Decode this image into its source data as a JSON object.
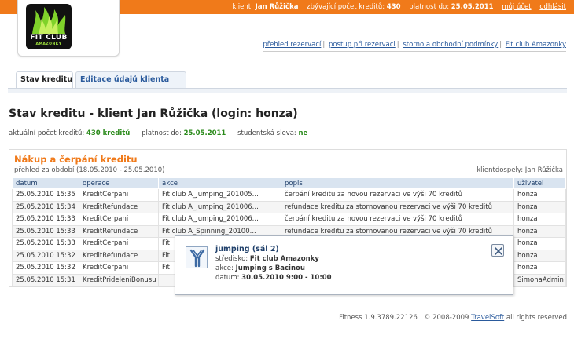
{
  "topbar": {
    "client_label": "klient:",
    "client_name": "Jan Růžička",
    "credits_label": "zbývající počet kreditů:",
    "credits_value": "430",
    "valid_label": "platnost do:",
    "valid_value": "25.05.2011",
    "account_link": "můj účet",
    "logout_link": "odhlásit",
    "accent_color": "#f07a1a"
  },
  "logo": {
    "line1": "FIT CLUB",
    "line2": "AMAZONKY"
  },
  "toplinks": [
    "přehled rezervací",
    "postup při rezervaci",
    "storno a obchodní podmínky",
    "Fit club Amazonky"
  ],
  "tabs": [
    {
      "label": "Stav kreditu",
      "active": true
    },
    {
      "label": "Editace údajů klienta",
      "active": false
    }
  ],
  "page_title": "Stav kreditu - klient Jan Růžička (login: honza)",
  "summary": {
    "credits_label": "aktuální počet kreditů:",
    "credits_value": "430 kreditů",
    "valid_label": "platnost do:",
    "valid_value": "25.05.2011",
    "student_label": "studentská sleva:",
    "student_value": "ne"
  },
  "panel": {
    "title": "Nákup a čerpání kreditu",
    "period": "přehled za období (18.05.2010 - 25.05.2010)",
    "user_info": "klientdospely: Jan Růžička",
    "columns": [
      "datum",
      "operace",
      "akce",
      "popis",
      "uživatel"
    ],
    "rows": [
      [
        "25.05.2010 15:35",
        "KreditCerpani",
        "Fit club A_Jumping_201005...",
        "čerpání kreditu za novou rezervaci ve výši 70 kreditů",
        "honza"
      ],
      [
        "25.05.2010 15:34",
        "KreditRefundace",
        "Fit club A_Jumping_201006...",
        "refundace kreditu za stornovanou rezervaci ve výši 70 kreditů",
        "honza"
      ],
      [
        "25.05.2010 15:33",
        "KreditCerpani",
        "Fit club A_Jumping_201006...",
        "čerpání kreditu za novou rezervaci ve výši 70 kreditů",
        "honza"
      ],
      [
        "25.05.2010 15:33",
        "KreditRefundace",
        "Fit club A_Spinning_20100...",
        "refundace kreditu za stornovanou rezervaci ve výši 70 kreditů",
        "honza"
      ],
      [
        "25.05.2010 15:33",
        "KreditCerpani",
        "Fit",
        "",
        "honza"
      ],
      [
        "25.05.2010 15:32",
        "KreditRefundace",
        "Fit",
        "",
        "honza"
      ],
      [
        "25.05.2010 15:32",
        "KreditCerpani",
        "Fit",
        "",
        "honza"
      ],
      [
        "25.05.2010 15:31",
        "KreditPrideleniBonusu",
        "",
        "",
        "SimonaAdmin"
      ]
    ]
  },
  "popup": {
    "title": "jumping (sál 2)",
    "center_label": "středisko:",
    "center_value": "Fit club Amazonky",
    "action_label": "akce:",
    "action_value": "Jumping s Bacinou",
    "date_label": "datum:",
    "date_value": "30.05.2010 9:00 - 10:00"
  },
  "footer": {
    "version": "Fitness 1.9.3789.22126",
    "copyright": "© 2008-2009",
    "company": "TravelSoft",
    "rights": "all rights reserved"
  }
}
